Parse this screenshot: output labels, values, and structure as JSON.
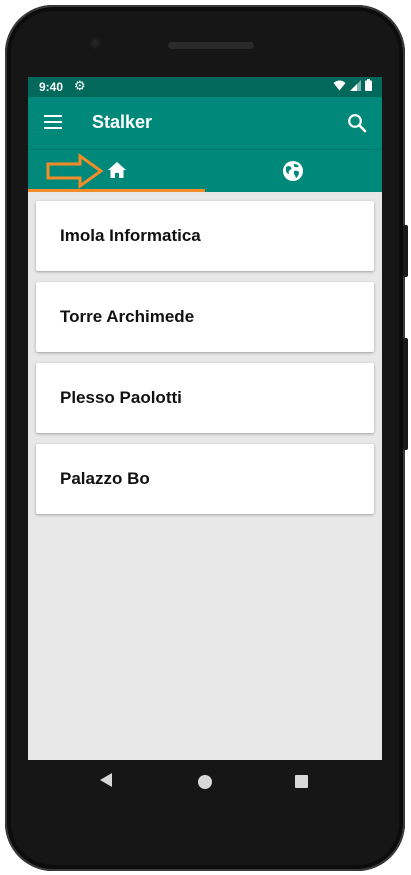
{
  "status_bar": {
    "time": "9:40"
  },
  "app_bar": {
    "title": "Stalker"
  },
  "tabs": [
    {
      "id": "home",
      "icon": "home-icon",
      "active": true
    },
    {
      "id": "map",
      "icon": "globe-icon",
      "active": false
    }
  ],
  "list": {
    "items": [
      {
        "label": "Imola Informatica"
      },
      {
        "label": "Torre Archimede"
      },
      {
        "label": "Plesso Paolotti"
      },
      {
        "label": "Palazzo Bo"
      }
    ]
  },
  "colors": {
    "status_bar": "#00695c",
    "app_bar": "#00897b",
    "tab_indicator": "#f28c28",
    "background": "#e8e8e8"
  }
}
